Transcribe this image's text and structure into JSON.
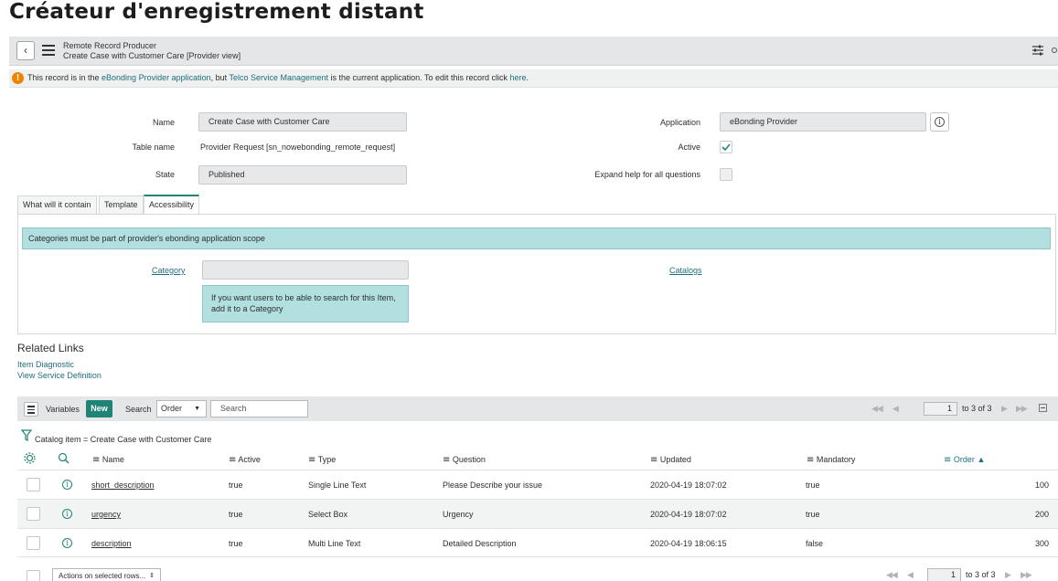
{
  "page_heading": "Créateur d'enregistrement distant",
  "header": {
    "breadcrumb_type": "Remote Record Producer",
    "record_title": "Create Case with Customer Care [Provider view]"
  },
  "notice": {
    "icon": "!",
    "text_1": "This record is in the ",
    "link_1": "eBonding Provider application",
    "text_2": ", but ",
    "link_2": "Telco Service Management",
    "text_3": " is the current application. To edit this record click ",
    "link_3": "here",
    "text_4": "."
  },
  "form": {
    "name_label": "Name",
    "name_value": "Create Case with Customer Care",
    "table_label": "Table name",
    "table_value": "Provider Request [sn_nowebonding_remote_request]",
    "state_label": "State",
    "state_value": "Published",
    "application_label": "Application",
    "application_value": "eBonding Provider",
    "active_label": "Active",
    "active_checked": true,
    "expand_label": "Expand help for all questions",
    "expand_checked": false
  },
  "tabs": [
    {
      "label": "What will it contain"
    },
    {
      "label": "Template"
    },
    {
      "label": "Accessibility"
    }
  ],
  "accessibility": {
    "banner": "Categories must be part of provider's ebonding application scope",
    "category_label": "Category",
    "category_value": "",
    "category_tip_1": "If you want users to be able to search for this Item,",
    "category_tip_2": "add it to a Category",
    "catalogs_label": "Catalogs"
  },
  "related_links": {
    "title": "Related Links",
    "items": [
      "Item Diagnostic",
      "View Service Definition"
    ]
  },
  "list": {
    "title": "Variables",
    "new_label": "New",
    "search_label": "Search",
    "search_field": "Order",
    "search_placeholder": "Search",
    "page_current": "1",
    "page_total_text": "to 3 of 3",
    "filter_text": "Catalog item = Create Case with Customer Care",
    "columns": [
      "Name",
      "Active",
      "Type",
      "Question",
      "Updated",
      "Mandatory",
      "Order"
    ],
    "sort_indicator": "▲",
    "rows": [
      {
        "name": "short_description",
        "active": "true",
        "type": "Single Line Text",
        "question": "Please Describe your issue",
        "updated": "2020-04-19 18:07:02",
        "mandatory": "true",
        "order": "100"
      },
      {
        "name": "urgency",
        "active": "true",
        "type": "Select Box",
        "question": "Urgency",
        "updated": "2020-04-19 18:07:02",
        "mandatory": "true",
        "order": "200"
      },
      {
        "name": "description",
        "active": "true",
        "type": "Multi Line Text",
        "question": "Detailed Description",
        "updated": "2020-04-19 18:06:15",
        "mandatory": "false",
        "order": "300"
      }
    ],
    "actions_label": "Actions on selected rows..."
  },
  "colors": {
    "accent": "#1f8476",
    "banner": "#b2dfe0",
    "link": "#1f6f7b",
    "warning": "#ee8300"
  }
}
